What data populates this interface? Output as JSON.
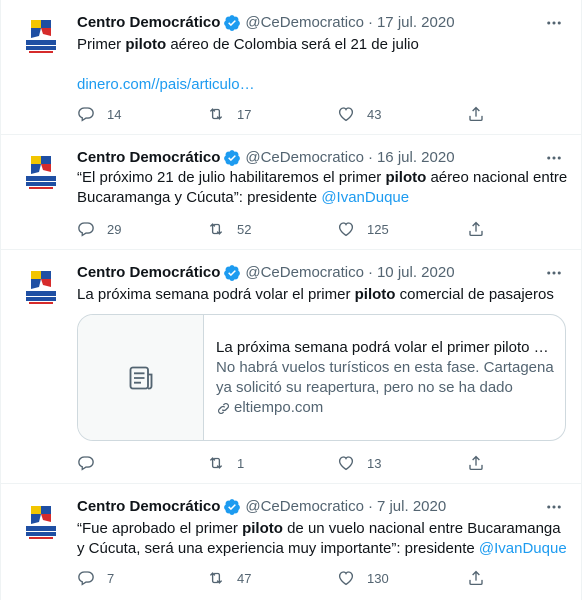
{
  "colors": {
    "accent": "#1d9bf0",
    "secondary_text": "#536471",
    "border": "#eff3f4"
  },
  "tweets": [
    {
      "author_name": "Centro Democrático",
      "handle": "@CeDemocratico",
      "separator": "·",
      "date": "17 jul. 2020",
      "text_before": "Primer ",
      "highlight": "piloto",
      "text_after": " aéreo de Colombia será el 21 de julio",
      "link": "dinero.com//pais/articulo…",
      "replies": "14",
      "retweets": "17",
      "likes": "43"
    },
    {
      "author_name": "Centro Democrático",
      "handle": "@CeDemocratico",
      "separator": "·",
      "date": "16 jul. 2020",
      "text_before": "“El próximo 21 de julio habilitaremos el primer ",
      "highlight": "piloto",
      "text_after": " aéreo nacional entre Bucaramanga y Cúcuta”: presidente ",
      "mention": "@IvanDuque",
      "replies": "29",
      "retweets": "52",
      "likes": "125"
    },
    {
      "author_name": "Centro Democrático",
      "handle": "@CeDemocratico",
      "separator": "·",
      "date": "10 jul. 2020",
      "text_before": "La próxima semana podrá volar el primer ",
      "highlight": "piloto",
      "text_after": " comercial de pasajeros",
      "card": {
        "title": "La próxima semana podrá volar el primer piloto c…",
        "description": "No habrá vuelos turísticos en esta fase. Cartagena ya solicitó su reapertura, pero no se ha dado",
        "domain": "eltiempo.com"
      },
      "replies": "",
      "retweets": "1",
      "likes": "13"
    },
    {
      "author_name": "Centro Democrático",
      "handle": "@CeDemocratico",
      "separator": "·",
      "date": "7 jul. 2020",
      "text_before": "“Fue aprobado el primer ",
      "highlight": "piloto",
      "text_after": " de un vuelo nacional entre Bucaramanga y Cúcuta, será una experiencia muy importante”: presidente ",
      "mention": "@IvanDuque",
      "replies": "7",
      "retweets": "47",
      "likes": "130"
    }
  ]
}
